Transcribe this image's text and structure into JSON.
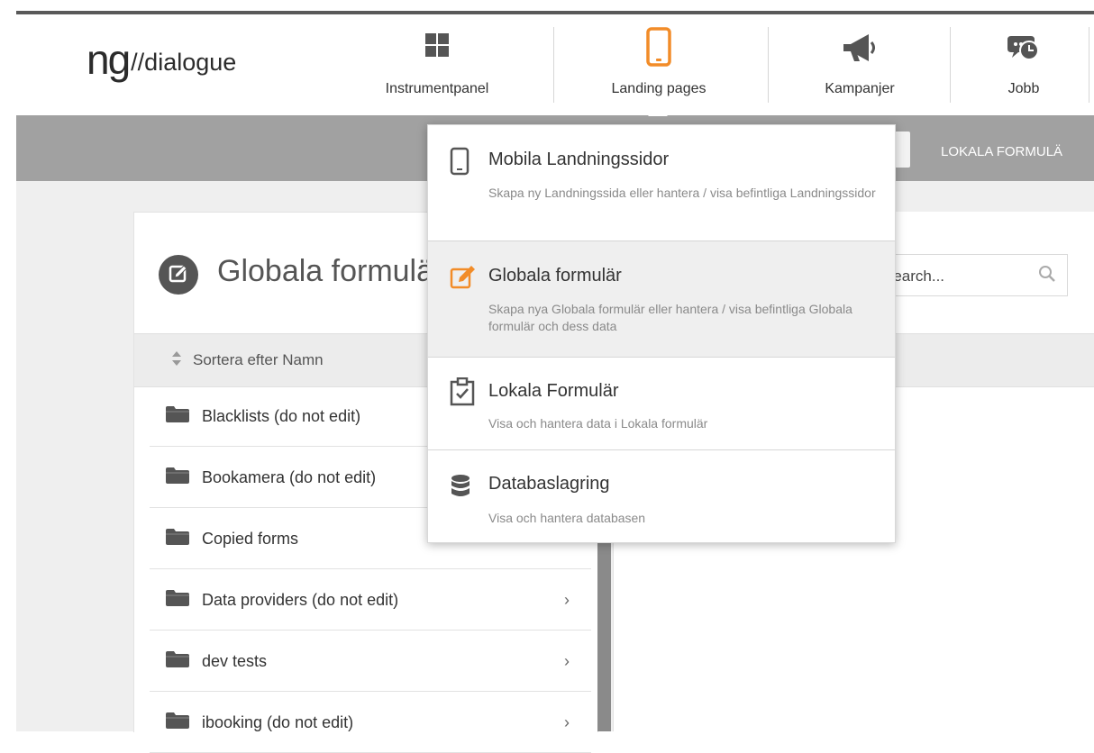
{
  "app": {
    "logo_ng": "ng",
    "logo_text": "//dialogue"
  },
  "nav": [
    {
      "label": "Instrumentpanel",
      "icon": "dashboard-grid-icon"
    },
    {
      "label": "Landing pages",
      "icon": "mobile-phone-icon",
      "active": true
    },
    {
      "label": "Kampanjer",
      "icon": "megaphone-icon"
    },
    {
      "label": "Jobb",
      "icon": "chat-clock-icon"
    }
  ],
  "subbar": {
    "link": "LOKALA FORMULÄ"
  },
  "page": {
    "title": "Globala formulär",
    "search_placeholder": "Search..."
  },
  "sort": {
    "label": "Sortera efter Namn"
  },
  "folders": [
    {
      "name": "Blacklists (do not edit)"
    },
    {
      "name": "Bookamera (do not edit)"
    },
    {
      "name": "Copied forms"
    },
    {
      "name": "Data providers (do not edit)"
    },
    {
      "name": "dev tests"
    },
    {
      "name": "ibooking (do not edit)"
    }
  ],
  "dropdown": [
    {
      "title": "Mobila Landningssidor",
      "desc": "Skapa ny Landningssida eller hantera / visa befintliga Landningssidor",
      "icon": "mobile-phone-icon"
    },
    {
      "title": "Globala formulär",
      "desc": "Skapa nya Globala formulär eller hantera / visa befintliga Globala formulär och dess data",
      "icon": "edit-icon",
      "active": true
    },
    {
      "title": "Lokala Formulär",
      "desc": "Visa och hantera data i Lokala formulär",
      "icon": "clipboard-check-icon"
    },
    {
      "title": "Databaslagring",
      "desc": "Visa och hantera databasen",
      "icon": "database-icon"
    }
  ],
  "colors": {
    "accent": "#f28c28",
    "subbar": "#a1a1a1",
    "text": "#333333"
  }
}
